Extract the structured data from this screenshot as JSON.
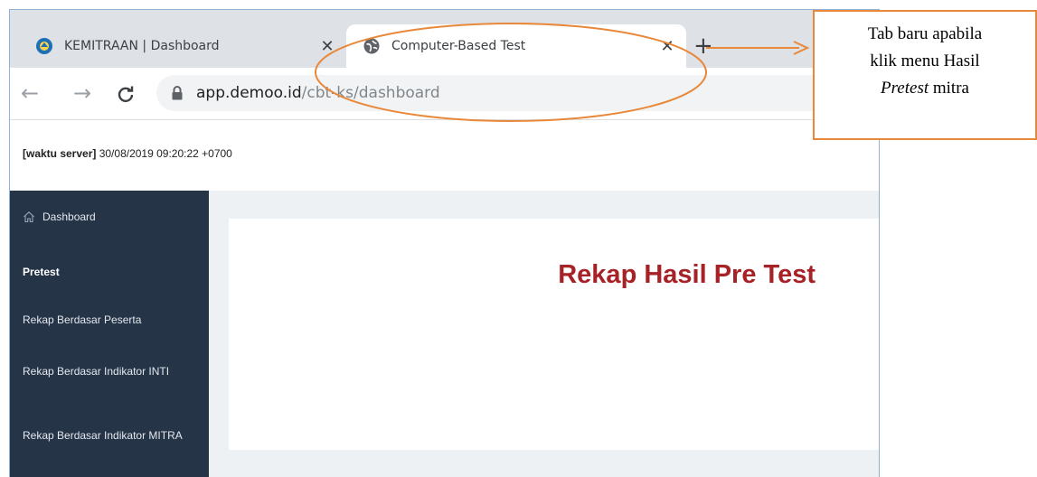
{
  "browser": {
    "tabs": [
      {
        "label": "KEMITRAAN | Dashboard",
        "close": "✕",
        "active": false
      },
      {
        "label": "Computer-Based Test",
        "close": "✕",
        "active": true
      }
    ],
    "new_tab": "+",
    "nav": {
      "back": "←",
      "forward": "→",
      "reload": "C"
    },
    "url": {
      "host": "app.demoo.id",
      "path": "/cbt-ks/dashboard"
    }
  },
  "page": {
    "server_time_label": "[waktu server]",
    "server_time_value": " 30/08/2019 09:20:22 +0700",
    "sidebar": {
      "items": [
        {
          "label": "Dashboard",
          "icon": "home-icon"
        },
        {
          "label": "Rekap Berdasar Peserta"
        },
        {
          "label": "Rekap Berdasar Indikator INTI"
        },
        {
          "label": "Rekap Berdasar Indikator MITRA"
        }
      ],
      "section_heading": "Pretest"
    },
    "main_title": "Rekap Hasil Pre Test"
  },
  "annotation": {
    "line1": "Tab baru apabila",
    "line2": "klik menu Hasil",
    "line3_em": "Pretest",
    "line3_rest": " mitra",
    "color": "#e8883a"
  },
  "colors": {
    "sidebar_bg": "#253447",
    "title_red": "#a62226",
    "accent_orange": "#e8883a"
  }
}
